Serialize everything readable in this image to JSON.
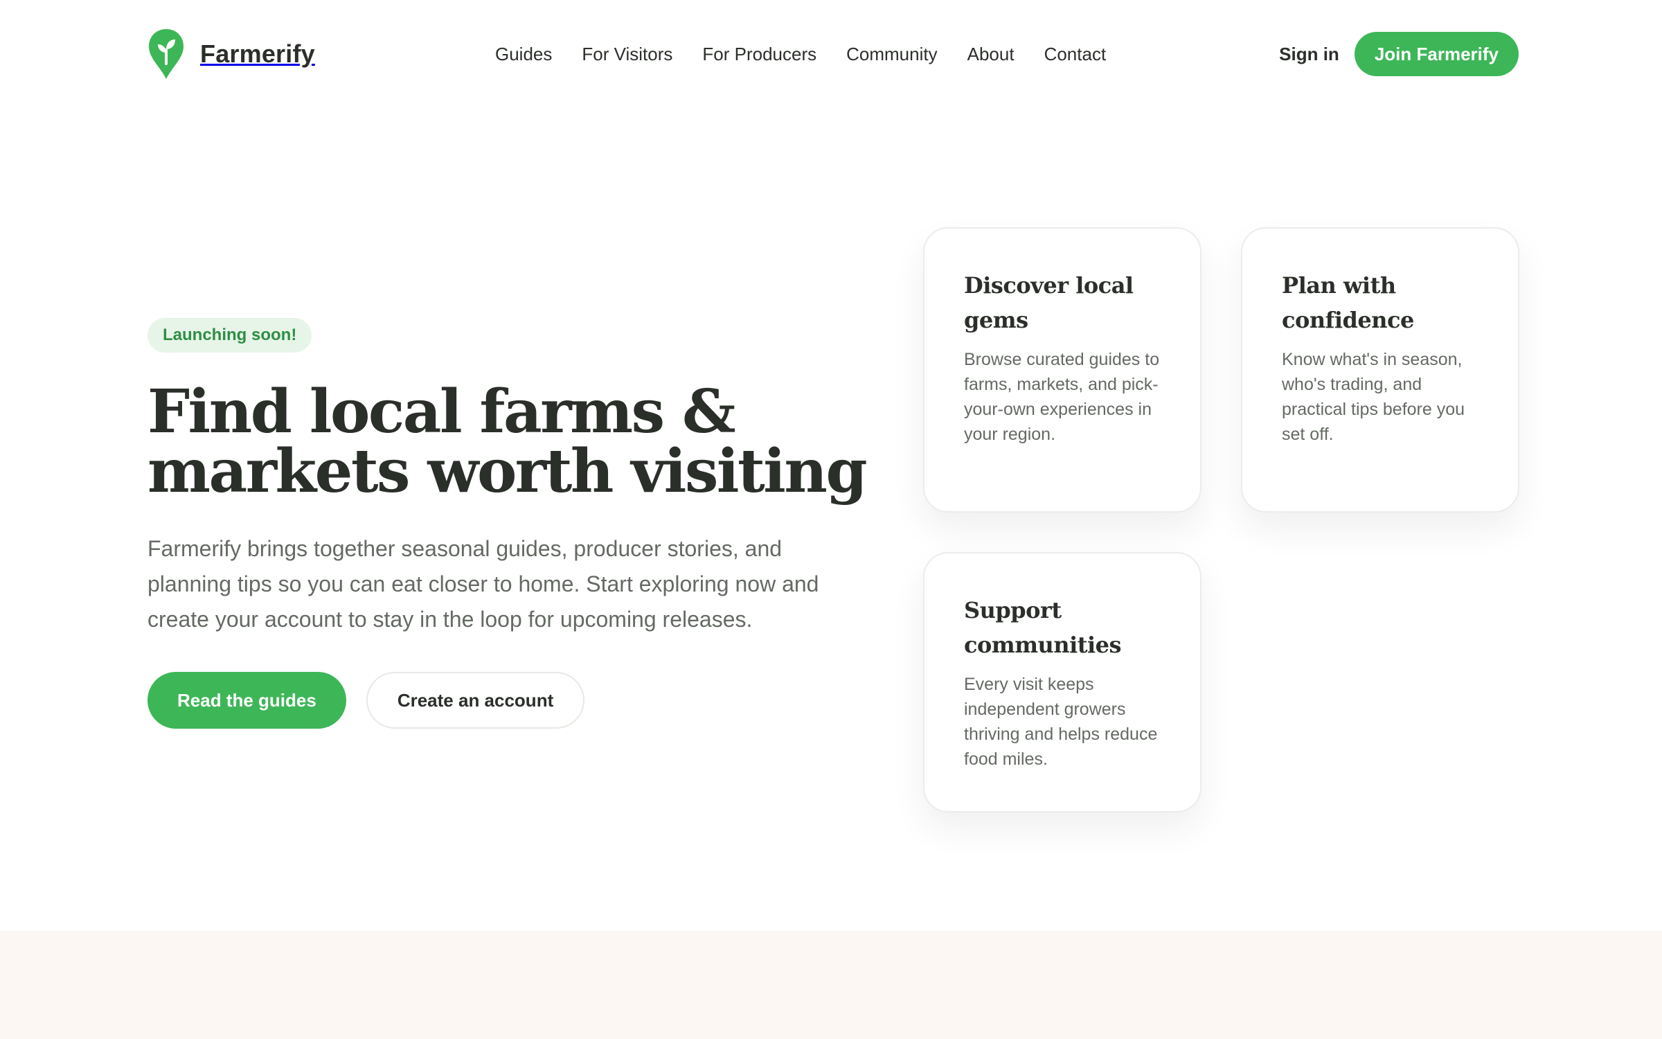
{
  "brand": {
    "name": "Farmerify",
    "accent_color": "#3db657",
    "logo_icon": "sprout-pin-icon"
  },
  "nav": {
    "items": [
      {
        "label": "Guides"
      },
      {
        "label": "For Visitors"
      },
      {
        "label": "For Producers"
      },
      {
        "label": "Community"
      },
      {
        "label": "About"
      },
      {
        "label": "Contact"
      }
    ]
  },
  "auth": {
    "sign_in": "Sign in",
    "join": "Join Farmerify"
  },
  "hero": {
    "badge": "Launching soon!",
    "headline_line1": "Find local farms &",
    "headline_line2": "markets worth visiting",
    "lead": "Farmerify brings together seasonal guides, producer stories, and planning tips so you can eat closer to home. Start exploring now and create your account to stay in the loop for upcoming releases.",
    "primary_cta": "Read the guides",
    "secondary_cta": "Create an account"
  },
  "features": [
    {
      "title": "Discover local gems",
      "body": "Browse curated guides to farms, markets, and pick-your-own experiences in your region."
    },
    {
      "title": "Plan with confidence",
      "body": "Know what's in season, who's trading, and practical tips before you set off."
    },
    {
      "title": "Support communities",
      "body": "Every visit keeps independent growers thriving and helps reduce food miles."
    }
  ],
  "colors": {
    "badge_bg": "#e7f5e9",
    "badge_text": "#2f8e45",
    "band_bg": "#fcf7f2"
  }
}
